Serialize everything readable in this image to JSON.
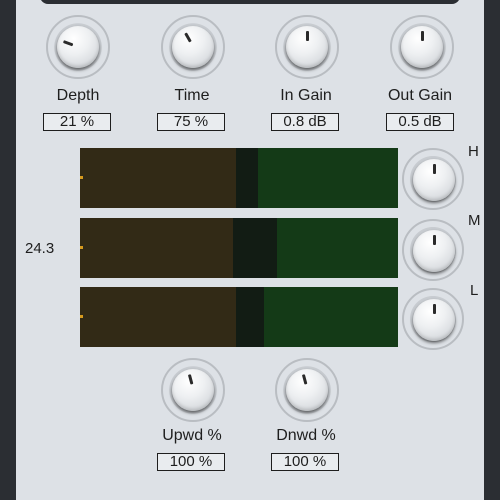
{
  "top_knobs": [
    {
      "label": "Depth",
      "value": "21 %",
      "angle": -70
    },
    {
      "label": "Time",
      "value": "75 %",
      "angle": -30
    },
    {
      "label": "In Gain",
      "value": "0.8 dB",
      "angle": 0
    },
    {
      "label": "Out Gain",
      "value": "0.5 dB",
      "angle": 0
    }
  ],
  "meters": [
    {
      "band": "H",
      "fill_a": 0.49,
      "fill_b_end": 0.56
    },
    {
      "band": "M",
      "fill_a": 0.48,
      "fill_b_end": 0.62
    },
    {
      "band": "L",
      "fill_a": 0.49,
      "fill_b_end": 0.58
    }
  ],
  "side_readout": "24.3",
  "bottom_knobs": [
    {
      "label": "Upwd %",
      "value": "100 %",
      "angle": -15
    },
    {
      "label": "Dnwd %",
      "value": "100 %",
      "angle": -15
    }
  ],
  "colors": {
    "panel": "#dde1e6",
    "meter_bg": "#143a17",
    "meter_fill": "#322a16",
    "meter_dark": "#121c14",
    "tick": "#d69a1e"
  }
}
